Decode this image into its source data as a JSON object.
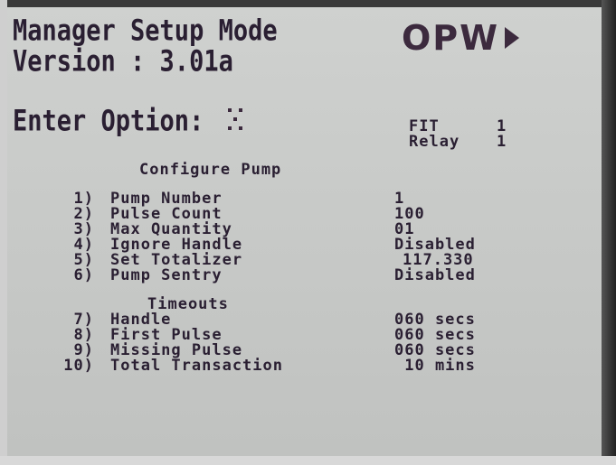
{
  "header": {
    "title": "Manager Setup Mode",
    "version": "Version : 3.01a"
  },
  "brand": {
    "logo": "OPW"
  },
  "prompt": {
    "label": "Enter Option:"
  },
  "status": {
    "fit_label": "FIT",
    "fit_value": "1",
    "relay_label": "Relay",
    "relay_value": "1"
  },
  "configure": {
    "heading": "Configure Pump",
    "options": [
      {
        "num": "1)",
        "label": "Pump Number",
        "value": "1"
      },
      {
        "num": "2)",
        "label": "Pulse Count",
        "value": "100"
      },
      {
        "num": "3)",
        "label": "Max Quantity",
        "value": "01"
      },
      {
        "num": "4)",
        "label": "Ignore Handle",
        "value": "Disabled"
      },
      {
        "num": "5)",
        "label": "Set Totalizer",
        "value": "117.330"
      },
      {
        "num": "6)",
        "label": "Pump Sentry",
        "value": "Disabled"
      }
    ]
  },
  "timeouts": {
    "heading": "Timeouts",
    "options": [
      {
        "num": "7)",
        "label": "Handle",
        "value": "060 secs"
      },
      {
        "num": "8)",
        "label": "First Pulse",
        "value": "060 secs"
      },
      {
        "num": "9)",
        "label": "Missing Pulse",
        "value": "060 secs"
      },
      {
        "num": "10)",
        "label": "Total Transaction",
        "value": " 10 mins"
      }
    ]
  },
  "colors": {
    "lcd_bg": "#c8cac8",
    "lcd_text": "#2a1f32"
  }
}
